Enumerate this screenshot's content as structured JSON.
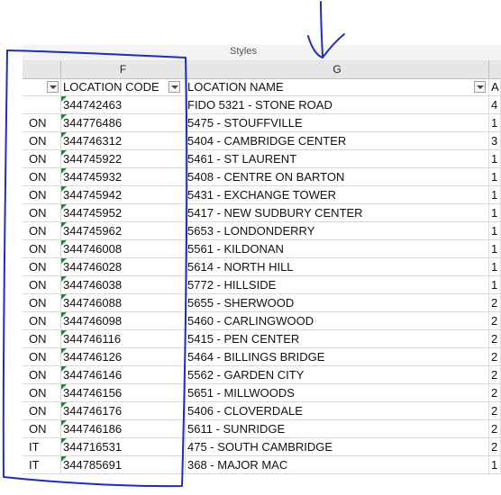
{
  "ribbon": {
    "group_label": "Styles"
  },
  "columns": {
    "f_letter": "F",
    "g_letter": "G"
  },
  "headers": {
    "e": "",
    "f": "LOCATION CODE",
    "g": "LOCATION NAME",
    "h": "A"
  },
  "rows": [
    {
      "e": "",
      "code": "344742463",
      "name": "FIDO 5321 - STONE ROAD",
      "h": "4"
    },
    {
      "e": "ON",
      "code": "344776486",
      "name": "5475 - STOUFFVILLE",
      "h": "1"
    },
    {
      "e": "ON",
      "code": "344746312",
      "name": "5404 - CAMBRIDGE CENTER",
      "h": "3"
    },
    {
      "e": "ON",
      "code": "344745922",
      "name": "5461 - ST LAURENT",
      "h": "1"
    },
    {
      "e": "ON",
      "code": "344745932",
      "name": "5408 - CENTRE ON BARTON",
      "h": "1"
    },
    {
      "e": "ON",
      "code": "344745942",
      "name": "5431 - EXCHANGE TOWER",
      "h": "1"
    },
    {
      "e": "ON",
      "code": "344745952",
      "name": "5417 - NEW SUDBURY CENTER",
      "h": "1"
    },
    {
      "e": "ON",
      "code": "344745962",
      "name": "5653 - LONDONDERRY",
      "h": "1"
    },
    {
      "e": "ON",
      "code": "344746008",
      "name": "5561 - KILDONAN",
      "h": "1"
    },
    {
      "e": "ON",
      "code": "344746028",
      "name": "5614 - NORTH HILL",
      "h": "1"
    },
    {
      "e": "ON",
      "code": "344746038",
      "name": "5772 - HILLSIDE",
      "h": "1"
    },
    {
      "e": "ON",
      "code": "344746088",
      "name": "5655 - SHERWOOD",
      "h": "2"
    },
    {
      "e": "ON",
      "code": "344746098",
      "name": "5460 - CARLINGWOOD",
      "h": "2"
    },
    {
      "e": "ON",
      "code": "344746116",
      "name": "5415 - PEN CENTER",
      "h": "2"
    },
    {
      "e": "ON",
      "code": "344746126",
      "name": "5464 - BILLINGS BRIDGE",
      "h": "2"
    },
    {
      "e": "ON",
      "code": "344746146",
      "name": "5562 - GARDEN CITY",
      "h": "2"
    },
    {
      "e": "ON",
      "code": "344746156",
      "name": "5651 - MILLWOODS",
      "h": "2"
    },
    {
      "e": "ON",
      "code": "344746176",
      "name": "5406 - CLOVERDALE",
      "h": "2"
    },
    {
      "e": "ON",
      "code": "344746186",
      "name": "5611 - SUNRIDGE",
      "h": "2"
    },
    {
      "e": "IT",
      "code": "344716531",
      "name": "475 - SOUTH CAMBRIDGE",
      "h": "2"
    },
    {
      "e": "IT",
      "code": "344785691",
      "name": "368 - MAJOR MAC",
      "h": "1"
    }
  ],
  "colors": {
    "annotation_ink": "#1f2fb5",
    "error_triangle": "#1e8b3a"
  }
}
